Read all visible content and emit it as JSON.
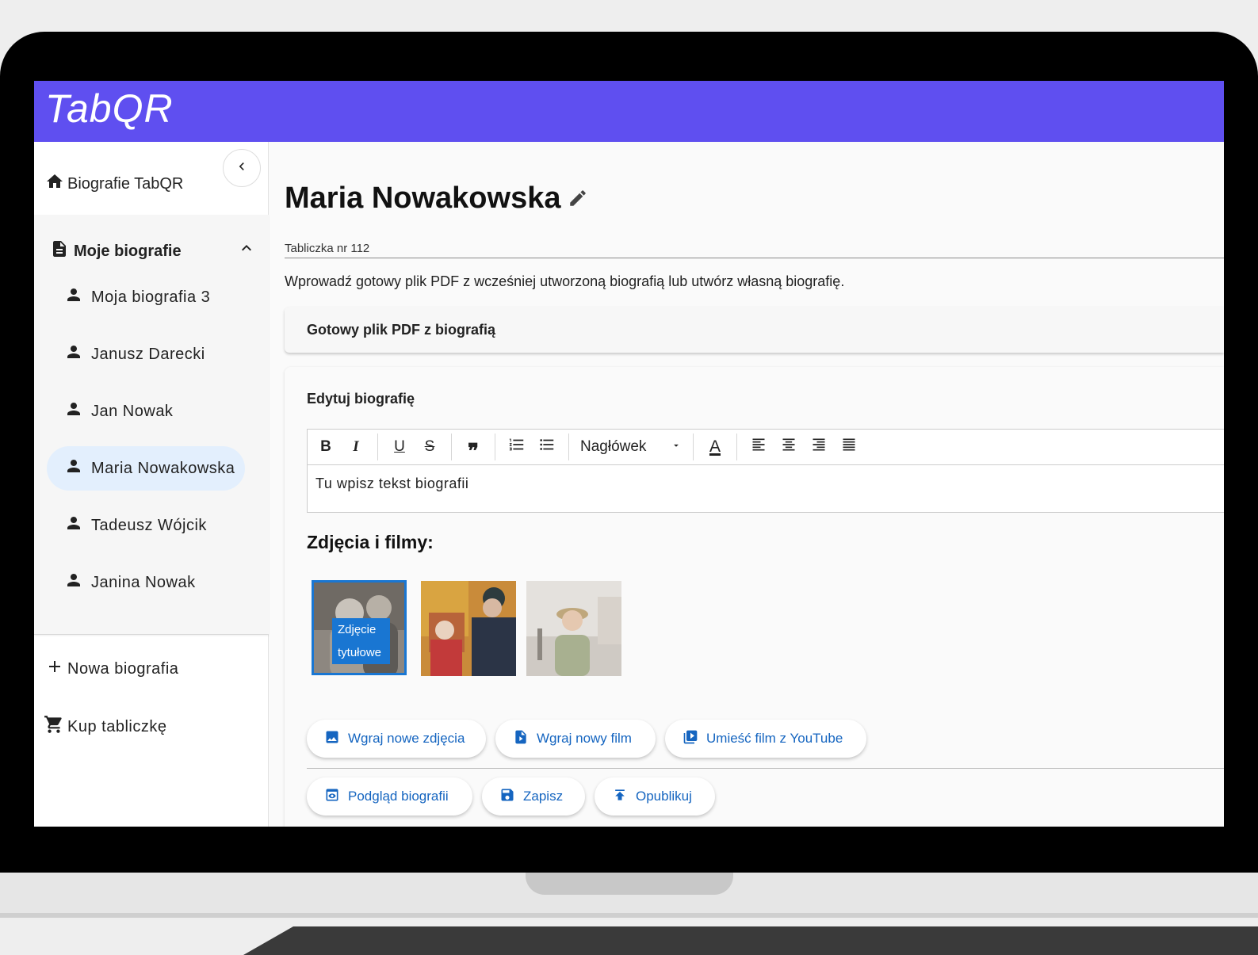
{
  "app": {
    "brand": "TabQR",
    "accent": "#5f4ff0",
    "link_color": "#1565c0"
  },
  "sidebar": {
    "home_label": "Biografie TabQR",
    "group_label": "Moje biografie",
    "items": [
      {
        "label": "Moja biografia 3",
        "active": false
      },
      {
        "label": "Janusz Darecki",
        "active": false
      },
      {
        "label": "Jan Nowak",
        "active": false
      },
      {
        "label": "Maria Nowakowska",
        "active": true
      },
      {
        "label": "Tadeusz Wójcik",
        "active": false
      },
      {
        "label": "Janina Nowak",
        "active": false
      }
    ],
    "new_label": "Nowa biografia",
    "buy_label": "Kup tabliczkę"
  },
  "main": {
    "title": "Maria Nowakowska",
    "plate_label": "Tabliczka nr 112",
    "intro": "Wprowadź gotowy plik PDF z wcześniej utworzoną biografią lub utwórz własną biografię.",
    "pdf_section_title": "Gotowy plik PDF z biografią",
    "edit_section_title": "Edytuj biografię",
    "editor": {
      "heading_select": "Nagłówek",
      "content": "Tu wpisz tekst biografii"
    },
    "media_title": "Zdjęcia i filmy:",
    "title_photo_badge": {
      "line1": "Zdjęcie",
      "line2": "tytułowe"
    },
    "upload_buttons": {
      "photos": "Wgraj nowe zdjęcia",
      "film": "Wgraj nowy film",
      "youtube": "Umieść film z YouTube"
    },
    "action_buttons": {
      "preview": "Podgląd biografii",
      "save": "Zapisz",
      "publish": "Opublikuj"
    }
  }
}
